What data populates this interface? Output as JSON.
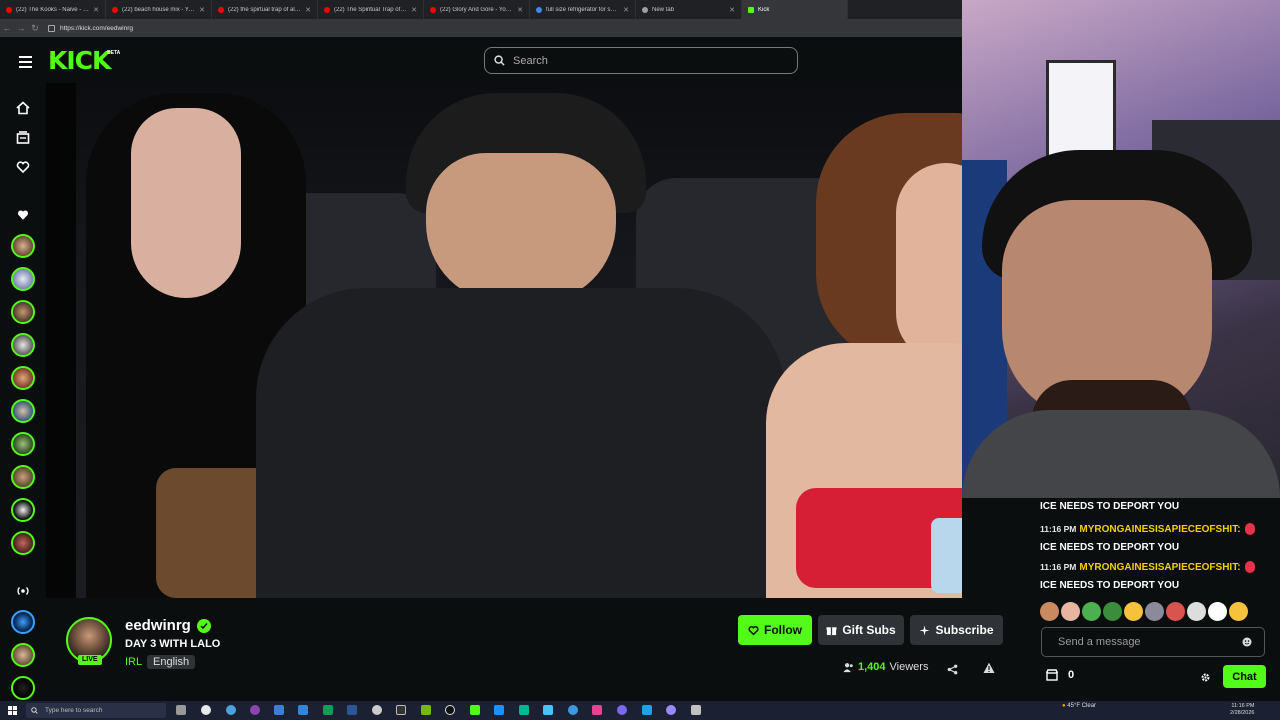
{
  "browser": {
    "tabs": [
      {
        "label": "(22) The Kooks - Naive - YouTube",
        "color": "#ff0000"
      },
      {
        "label": "(22) beach house mix - YouTube",
        "color": "#ff0000"
      },
      {
        "label": "(22) the spirtual trap of alcohol - ",
        "color": "#ff0000"
      },
      {
        "label": "(22) The Spiritual Trap of Alcohol | ",
        "color": "#ff0000"
      },
      {
        "label": "(22) Glory And Gore - YouTube",
        "color": "#ff0000"
      },
      {
        "label": "full size refrigerator for sale - Goo",
        "color": "#4285f4"
      },
      {
        "label": "New tab",
        "color": "#9aa0a6"
      },
      {
        "label": "Kick",
        "color": "#53fc18"
      }
    ],
    "url": "https://kick.com/eedwinrg"
  },
  "kick": {
    "logo": "KICK",
    "beta": "BETA",
    "search_placeholder": "Search"
  },
  "channel": {
    "name": "eedwinrg",
    "live": "LIVE",
    "title": "DAY 3 WITH LALO",
    "category": "IRL",
    "language": "English",
    "follow": "Follow",
    "gift_subs": "Gift Subs",
    "subscribe": "Subscribe",
    "viewers_count": "1,404",
    "viewers_label": "Viewers"
  },
  "chat": {
    "messages": [
      {
        "time": "",
        "user": "",
        "text": "ICE NEEDS TO DEPORT YOU"
      },
      {
        "time": "11:16 PM",
        "user": "MYRONGAINESISAPIECEOFSHIT:",
        "text": "ICE NEEDS TO DEPORT YOU"
      },
      {
        "time": "11:16 PM",
        "user": "MYRONGAINESISAPIECEOFSHIT:",
        "text": "ICE NEEDS TO DEPORT YOU"
      }
    ],
    "input_placeholder": "Send a message",
    "points": "0",
    "chat_button": "Chat"
  },
  "taskbar": {
    "search_placeholder": "Type here to search",
    "weather": "45°F Clear",
    "time": "11:16 PM",
    "date": "2/28/2026"
  }
}
